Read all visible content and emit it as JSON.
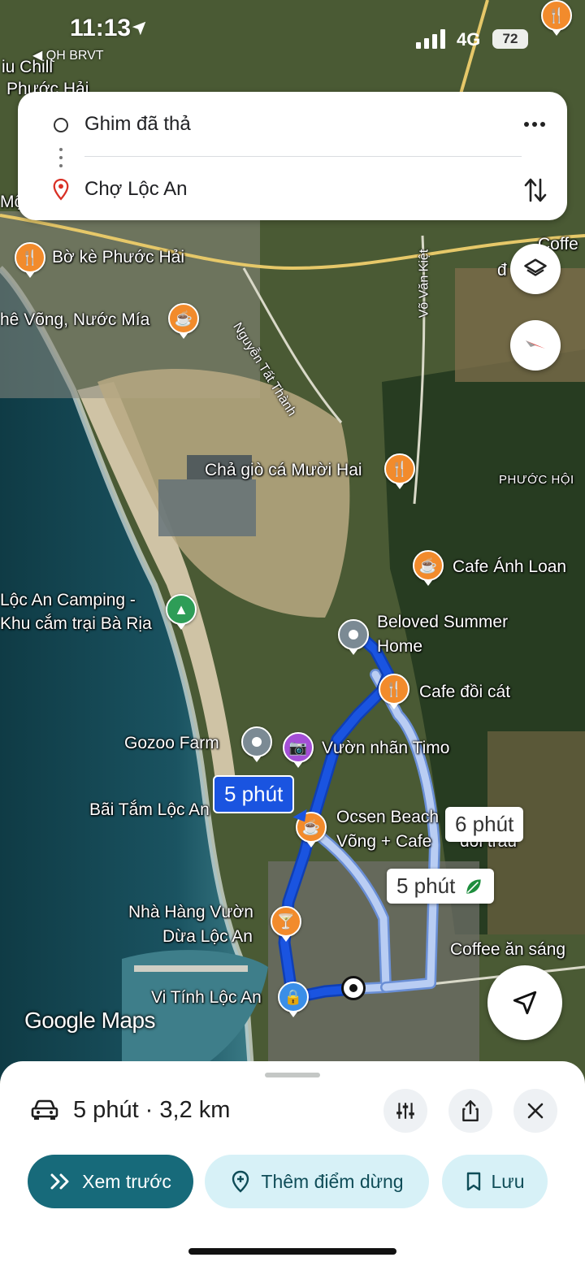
{
  "status_bar": {
    "time": "11:13",
    "back_app": "◀ QH BRVT",
    "network": "4G",
    "battery": "72"
  },
  "directions": {
    "origin": "Ghim đã thả",
    "destination": "Chợ Lộc An"
  },
  "map": {
    "labels": {
      "iu_chill": "iu Chill",
      "phuoc_hai_top": "Phước Hải",
      "mo": "Mộ",
      "bo_ke": "Bờ kè Phước Hải",
      "che_vong": "hê Võng, Nước Mía",
      "nguyen_tat_thanh": "Nguyễn Tất Thành",
      "vo_van_kiet": "Võ Văn Kiệt",
      "coffee_top": "Coffe",
      "coffee_top2": "đ",
      "cha_gio": "Chả giò cá Mười Hai",
      "phuoc_hoi": "PHƯỚC HỘI",
      "cafe_anh_loan": "Cafe Ánh Loan",
      "loc_an_camping_1": "Lộc An Camping -",
      "loc_an_camping_2": "Khu cắm trại Bà Rịa",
      "beloved_1": "Beloved Summer",
      "beloved_2": "Home",
      "cafe_doi_cat": "Cafe đồi cát",
      "gozoo": "Gozoo Farm",
      "vuon_nhan": "Vườn nhãn Timo",
      "bai_tam": "Bãi Tắm Lộc An",
      "ocsen_1": "Ocsen Beach",
      "ocsen_2": "Võng + Cafe",
      "ocsen_2b": "đồi trầu",
      "nha_hang_1": "Nhà Hàng Vườn",
      "nha_hang_2": "Dừa Lộc An",
      "coffee_an_sang": "Coffee ăn sáng",
      "vi_tinh": "Vi Tính Lộc An"
    },
    "route_badges": {
      "primary": "5 phút",
      "alt_1": "6 phút",
      "alt_2": "5 phút"
    },
    "logo": "Google Maps",
    "colors": {
      "route_primary": "#1a54e0",
      "route_alt": "#b9cdf3",
      "poi_food": "#f28b2c",
      "poi_photo": "#a44fd6"
    }
  },
  "bottom_sheet": {
    "summary": "5 phút · 3,2 km",
    "buttons": {
      "preview": "Xem trước",
      "add_stop": "Thêm điểm dừng",
      "save": "Lưu"
    }
  }
}
